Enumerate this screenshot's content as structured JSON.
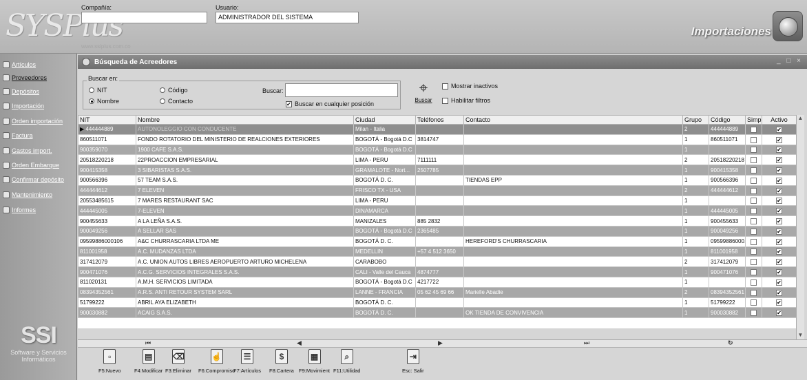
{
  "header": {
    "company_label": "Compañía:",
    "company_value": "",
    "user_label": "Usuario:",
    "user_value": "ADMINISTRADOR DEL SISTEMA",
    "website": "www.ssiplus.com.co",
    "module_title": "Importaciones",
    "logo_text": "SYSPlus"
  },
  "sidebar": {
    "items": [
      {
        "label": "Artículos",
        "icon": "box-icon"
      },
      {
        "label": "Proveedores",
        "icon": "users-icon"
      },
      {
        "label": "Depósitos",
        "icon": "warehouse-icon"
      },
      {
        "label": "Importación",
        "icon": "import-icon"
      },
      {
        "label": "Orden importación",
        "icon": "order-icon"
      },
      {
        "label": "Factura",
        "icon": "invoice-icon"
      },
      {
        "label": "Gastos import.",
        "icon": "expenses-icon"
      },
      {
        "label": "Orden Embarque",
        "icon": "ship-icon"
      },
      {
        "label": "Confirmar depósito",
        "icon": "confirm-icon"
      },
      {
        "label": "Mantenimiento",
        "icon": "gear-icon"
      },
      {
        "label": "Informes",
        "icon": "printer-icon"
      }
    ],
    "footer_logo": "SSI",
    "footer_line1": "Software y Servicios",
    "footer_line2": "Informáticos"
  },
  "panel": {
    "title": "Búsqueda de Acreedores",
    "search_in_label": "Buscar en:",
    "radio_nit": "NIT",
    "radio_codigo": "Código",
    "radio_nombre": "Nombre",
    "radio_contacto": "Contacto",
    "selected_radio": "Nombre",
    "search_label": "Buscar:",
    "search_value": "",
    "any_position_label": "Buscar en cualquier posición",
    "search_button": "Buscar",
    "show_inactive": "Mostrar inactivos",
    "enable_filters": "Habilitar filtros"
  },
  "table": {
    "columns": [
      "NIT",
      "Nombre",
      "Ciudad",
      "Teléfonos",
      "Contacto",
      "Grupo",
      "Código",
      "Simpl.",
      "Activo"
    ],
    "rows": [
      {
        "nit": "444444889",
        "nombre": "AUTONOLEGGIO CON CONDUCENTE",
        "ciudad": "Milan - Italia",
        "tel": "",
        "contacto": "",
        "grupo": "2",
        "codigo": "444444889",
        "simpl": false,
        "activo": true
      },
      {
        "nit": "860511071",
        "nombre": " FONDO ROTATORIO DEL MINISTERIO DE REALCIONES EXTERIORES",
        "ciudad": "BOGOTÁ - Bogotá D.C",
        "tel": "3814747",
        "contacto": "",
        "grupo": "1",
        "codigo": "860511071",
        "simpl": false,
        "activo": true
      },
      {
        "nit": "900359070",
        "nombre": "1900 CAFE S.A.S.",
        "ciudad": "BOGOTÁ - Bogotá D.C",
        "tel": "",
        "contacto": "",
        "grupo": "1",
        "codigo": "",
        "simpl": false,
        "activo": true
      },
      {
        "nit": "20518220218",
        "nombre": "22PROACCION EMPRESARIAL",
        "ciudad": "LIMA - PERU",
        "tel": "7111111",
        "contacto": "",
        "grupo": "2",
        "codigo": "20518220218",
        "simpl": false,
        "activo": true
      },
      {
        "nit": "900415358",
        "nombre": "3 SIBARISTAS S.A.S.",
        "ciudad": "GRAMALOTE - Nort...",
        "tel": "2507785",
        "contacto": "",
        "grupo": "1",
        "codigo": "900415358",
        "simpl": false,
        "activo": true
      },
      {
        "nit": "900566396",
        "nombre": "57 TEAM S.A.S.",
        "ciudad": "BOGOTÁ D. C.",
        "tel": "",
        "contacto": "TIENDAS EPP",
        "grupo": "1",
        "codigo": "900566396",
        "simpl": false,
        "activo": true
      },
      {
        "nit": "444444612",
        "nombre": "7 ELEVEN",
        "ciudad": "FRISCO TX - USA",
        "tel": "",
        "contacto": "",
        "grupo": "2",
        "codigo": "444444612",
        "simpl": false,
        "activo": true
      },
      {
        "nit": "20553485615",
        "nombre": "7 MARES RESTAURANT SAC",
        "ciudad": "LIMA - PERU",
        "tel": "",
        "contacto": "",
        "grupo": "1",
        "codigo": "",
        "simpl": false,
        "activo": true
      },
      {
        "nit": "444445005",
        "nombre": "7-ELEVEN",
        "ciudad": "DINAMARCA",
        "tel": "",
        "contacto": "",
        "grupo": "1",
        "codigo": "444445005",
        "simpl": false,
        "activo": true
      },
      {
        "nit": "900455633",
        "nombre": "A LA LEÑA S.A.S.",
        "ciudad": "MANIZALES",
        "tel": "885 2832",
        "contacto": "",
        "grupo": "1",
        "codigo": "900455633",
        "simpl": false,
        "activo": true
      },
      {
        "nit": "900049256",
        "nombre": "A SELLAR SAS",
        "ciudad": "BOGOTÁ - Bogotá D.C",
        "tel": "2365485",
        "contacto": "",
        "grupo": "1",
        "codigo": "900049256",
        "simpl": false,
        "activo": true
      },
      {
        "nit": "09599886000106",
        "nombre": "A&C CHURRASCARIA LTDA ME",
        "ciudad": "BOGOTÁ D. C.",
        "tel": "",
        "contacto": "HEREFORD'S CHURRASCARIA",
        "grupo": "1",
        "codigo": "09599886000...",
        "simpl": false,
        "activo": true
      },
      {
        "nit": "811001958",
        "nombre": "A.C. MUDANZAS LTDA",
        "ciudad": "MEDELLIN",
        "tel": "+57 4 512 3650",
        "contacto": "",
        "grupo": "1",
        "codigo": "811001958",
        "simpl": false,
        "activo": true
      },
      {
        "nit": "317412079",
        "nombre": "A.C. UNION AUTOS LIBRES AEROPUERTO ARTURO MICHELENA",
        "ciudad": "CARABOBO",
        "tel": "",
        "contacto": "",
        "grupo": "2",
        "codigo": "317412079",
        "simpl": false,
        "activo": true
      },
      {
        "nit": "900471076",
        "nombre": "A.C.G. SERVICIOS INTEGRALES S.A.S.",
        "ciudad": "CALI - Valle del Cauca",
        "tel": "4874777",
        "contacto": "",
        "grupo": "1",
        "codigo": "900471076",
        "simpl": false,
        "activo": true
      },
      {
        "nit": "811020131",
        "nombre": "A.M.H. SERVICIOS LIMITADA",
        "ciudad": "BOGOTÁ - Bogotá D.C",
        "tel": "4217722",
        "contacto": "",
        "grupo": "1",
        "codigo": "",
        "simpl": false,
        "activo": true
      },
      {
        "nit": "08394352561",
        "nombre": "A.R.S. ANTI RETOUR SYSTEM SARL",
        "ciudad": "LANNE - FRANCIA",
        "tel": "05 62 45 69 66",
        "contacto": "Marielle Abadie",
        "grupo": "2",
        "codigo": "08394352561",
        "simpl": false,
        "activo": true
      },
      {
        "nit": "51799222",
        "nombre": "ABRIL AYA ELIZABETH",
        "ciudad": "BOGOTÁ D. C.",
        "tel": "",
        "contacto": "",
        "grupo": "1",
        "codigo": "51799222",
        "simpl": false,
        "activo": true
      },
      {
        "nit": "900030882",
        "nombre": "ACAIG S.A.S.",
        "ciudad": "BOGOTÁ D. C.",
        "tel": "",
        "contacto": "OK TIENDA DE CONVIVENCIA",
        "grupo": "1",
        "codigo": "900030882",
        "simpl": false,
        "activo": true
      }
    ]
  },
  "navbar": {
    "first": "⏮",
    "prev": "◀",
    "next": "▶",
    "last": "⏭",
    "refresh": "↻"
  },
  "toolbar": {
    "buttons": [
      {
        "label": "F5:Nuevo",
        "icon": "new-document-icon",
        "glyph": "▫"
      },
      {
        "label": "F4:Modificar",
        "icon": "edit-printer-icon",
        "glyph": "▤"
      },
      {
        "label": "F3:Eliminar",
        "icon": "eraser-icon",
        "glyph": "⌫"
      },
      {
        "label": "F6:Compromiso",
        "icon": "hand-icon",
        "glyph": "☝"
      },
      {
        "label": "F7:Artículos",
        "icon": "list-icon",
        "glyph": "☰"
      },
      {
        "label": "F8:Cartera",
        "icon": "dollar-icon",
        "glyph": "$"
      },
      {
        "label": "F9:Movimient",
        "icon": "ledger-icon",
        "glyph": "▦"
      },
      {
        "label": "F11:Utilidad",
        "icon": "magnifier-icon",
        "glyph": "⌕"
      },
      {
        "label": "Esc: Salir",
        "icon": "exit-icon",
        "glyph": "⇥"
      }
    ]
  }
}
